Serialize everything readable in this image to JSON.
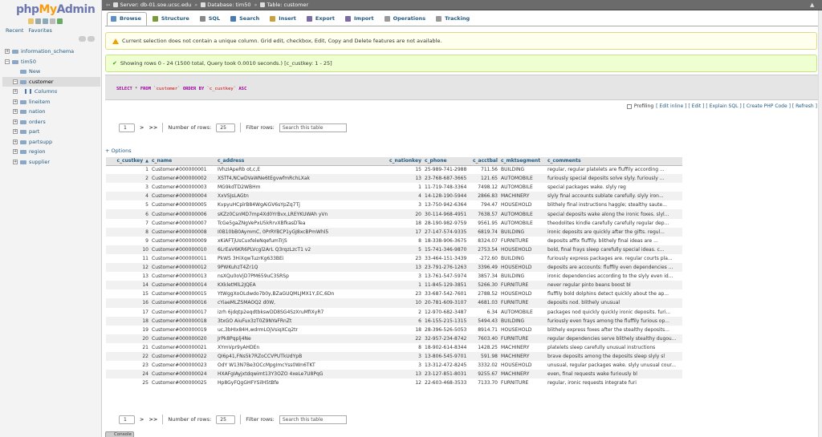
{
  "logo": {
    "php": "php",
    "my": "My",
    "admin": "Admin"
  },
  "nav": {
    "tab_recent": "Recent",
    "tab_favorites": "Favorites",
    "tree": [
      {
        "label": "information_schema",
        "level": 0,
        "expander": "+"
      },
      {
        "label": "tim50",
        "level": 0,
        "expander": "−"
      },
      {
        "label": "New",
        "level": 1,
        "expander": ""
      },
      {
        "label": "customer",
        "level": 1,
        "expander": "−",
        "selected": true
      },
      {
        "label": "Columns",
        "level": 2,
        "expander": "+"
      },
      {
        "label": "lineitem",
        "level": 1,
        "expander": "+"
      },
      {
        "label": "nation",
        "level": 1,
        "expander": "+"
      },
      {
        "label": "orders",
        "level": 1,
        "expander": "+"
      },
      {
        "label": "part",
        "level": 1,
        "expander": "+"
      },
      {
        "label": "partsupp",
        "level": 1,
        "expander": "+"
      },
      {
        "label": "region",
        "level": 1,
        "expander": "+"
      },
      {
        "label": "supplier",
        "level": 1,
        "expander": "+"
      }
    ]
  },
  "breadcrumb": {
    "server": "Server: db-01.soe.ucsc.edu",
    "database": "Database: tim50",
    "table": "Table: customer"
  },
  "tabs": [
    {
      "label": "Browse",
      "name": "tab-browse",
      "active": true,
      "color": "#5b8fc6"
    },
    {
      "label": "Structure",
      "name": "tab-structure",
      "color": "#7a9a3a"
    },
    {
      "label": "SQL",
      "name": "tab-sql",
      "color": "#888888"
    },
    {
      "label": "Search",
      "name": "tab-search",
      "color": "#4a7bb0"
    },
    {
      "label": "Insert",
      "name": "tab-insert",
      "color": "#c8a040"
    },
    {
      "label": "Export",
      "name": "tab-export",
      "color": "#7b6aa8"
    },
    {
      "label": "Import",
      "name": "tab-import",
      "color": "#7b6aa8"
    },
    {
      "label": "Operations",
      "name": "tab-operations",
      "color": "#999999"
    },
    {
      "label": "Tracking",
      "name": "tab-tracking",
      "color": "#999999"
    }
  ],
  "messages": {
    "warning": "Current selection does not contain a unique column. Grid edit, checkbox, Edit, Copy and Delete features are not available.",
    "success": "Showing rows 0 - 24 (1500 total, Query took 0.0010 seconds.) [c_custkey: 1 - 25]"
  },
  "sql": {
    "kw1": "SELECT",
    "star": " * ",
    "kw2": "FROM",
    "table": " `customer` ",
    "kw3": "ORDER BY",
    "col": " `c_custkey` ",
    "kw4": "ASC"
  },
  "profiling": {
    "label": "Profiling",
    "links": "[ Edit inline ] [ Edit ] [ Explain SQL ] [ Create PHP Code ] [ Refresh ]"
  },
  "pager": {
    "page": "1",
    "next": ">",
    "last": ">>",
    "rows_label": "Number of rows:",
    "rows_value": "25",
    "filter_label": "Filter rows:",
    "filter_placeholder": "Search this table"
  },
  "options_label": "+ Options",
  "table": {
    "headers": [
      "c_custkey",
      "c_name",
      "c_address",
      "c_nationkey",
      "c_phone",
      "c_acctbal",
      "c_mktsegment",
      "c_comments"
    ],
    "sort_arrow": "▲",
    "rows": [
      [
        "1",
        "Customer#000000001",
        "IVhzIApeRb ot,c,E",
        "15",
        "25-989-741-2988",
        "711.56",
        "BUILDING",
        "regular, regular platelets are fluffily according ..."
      ],
      [
        "2",
        "Customer#000000002",
        "XSTf4,NCwDVaWNe6tEgvwfmRchLXak",
        "13",
        "23-768-687-3665",
        "121.65",
        "AUTOMOBILE",
        "furiously special deposits solve slyly. furiously ..."
      ],
      [
        "3",
        "Customer#000000003",
        "MG9kdTD2WBHm",
        "1",
        "11-719-748-3364",
        "7498.12",
        "AUTOMOBILE",
        "special packages wake. slyly reg"
      ],
      [
        "4",
        "Customer#000000004",
        "XxVSJsLAGtn",
        "4",
        "14-128-190-5944",
        "2866.83",
        "MACHINERY",
        "slyly final accounts sublate carefully. slyly iron..."
      ],
      [
        "5",
        "Customer#000000005",
        "KvpyuHCplrB84WgAiGV6sYpZq7Tj",
        "3",
        "13-750-942-6364",
        "794.47",
        "HOUSEHOLD",
        "blithely final instructions haggle; stealthy saute..."
      ],
      [
        "6",
        "Customer#000000006",
        "sKZz0CsnMD7mp4Xd0YrBvx,LREYKUWAh yVn",
        "20",
        "30-114-968-4951",
        "7638.57",
        "AUTOMOBILE",
        "special deposits wake along the ironic foxes. slyl..."
      ],
      [
        "7",
        "Customer#000000007",
        "TcGe5gaZNgVePxU5kRrvXBfkasDTea",
        "18",
        "28-190-982-9759",
        "9561.95",
        "AUTOMOBILE",
        "theodolites kindle carefully carefully regular dep..."
      ],
      [
        "8",
        "Customer#000000008",
        "I0B10bB0AymmC, 0PrRYBCP1yGJ8xcBPmWhl5",
        "17",
        "27-147-574-9335",
        "6819.74",
        "BUILDING",
        "ironic deposits are quickly after the gifts. regul..."
      ],
      [
        "9",
        "Customer#000000009",
        "xKiAFTjUsCuxfeleNqefumTrjS",
        "8",
        "18-338-906-3675",
        "8324.07",
        "FURNITURE",
        "deposits affix fluffily. blithely final ideas are ..."
      ],
      [
        "10",
        "Customer#000000010",
        "6LrEaV6KR6PLVcgl2ArL Q3rqzLzcT1 v2",
        "5",
        "15-741-346-9870",
        "2753.54",
        "HOUSEHOLD",
        "bold, final frays sleep carefully special ideas. c..."
      ],
      [
        "11",
        "Customer#000000011",
        "PkWS 3HiXqwTuzrKg633BEi",
        "23",
        "33-464-151-3439",
        "-272.60",
        "BUILDING",
        "furiously express packages are. regular courts pla..."
      ],
      [
        "12",
        "Customer#000000012",
        "9PWKuhzT4Zr1Q",
        "13",
        "23-791-276-1263",
        "3396.49",
        "HOUSEHOLD",
        "deposits are accounts: fluffily even dependencies ..."
      ],
      [
        "13",
        "Customer#000000013",
        "nsXQu0oVjD7PM659uC3SRSp",
        "3",
        "13-761-547-5974",
        "3857.34",
        "BUILDING",
        "ironic dependencies according to the slyly even id..."
      ],
      [
        "14",
        "Customer#000000014",
        "KXkletMlL2JQEA",
        "1",
        "11-845-129-3851",
        "5266.30",
        "FURNITURE",
        "never regular pinto beans boost bl"
      ],
      [
        "15",
        "Customer#000000015",
        "YtWggXoOLdwdo7b0y,BZaGUQMLJMX1Y,EC,6Dn",
        "23",
        "33-687-542-7601",
        "2788.52",
        "HOUSEHOLD",
        "fluffily bold dolphins detect quickly about the ap..."
      ],
      [
        "16",
        "Customer#000000016",
        "cYiaeMLZSMAOQ2 d0W,",
        "10",
        "20-781-609-3107",
        "4681.03",
        "FURNITURE",
        "deposits nod. blithely unusual"
      ],
      [
        "17",
        "Customer#000000017",
        "izrh 6jdqtp2eqdtbkswDD8SG4SzXruMfIXyR7",
        "2",
        "12-970-682-3487",
        "6.34",
        "AUTOMOBILE",
        "packages nod quickly quickly ironic deposits. furi..."
      ],
      [
        "18",
        "Customer#000000018",
        "3txGO AiuFux3zT0Z9NYaFRnZt",
        "6",
        "16-155-215-1315",
        "5494.43",
        "BUILDING",
        "furiously even frays among the fluffily furious op..."
      ],
      [
        "19",
        "Customer#000000019",
        "uc,3bHIx84H,wdrmLOjVsiqXCq2tr",
        "18",
        "28-396-526-5053",
        "8914.71",
        "HOUSEHOLD",
        "blithely express foxes after the stealthy deposits..."
      ],
      [
        "20",
        "Customer#000000020",
        "JrPk8Pqplj4Ne",
        "22",
        "32-957-234-8742",
        "7603.40",
        "FURNITURE",
        "regular dependencies serve blithely stealthy dugou..."
      ],
      [
        "21",
        "Customer#000000021",
        "XYmVpr9yAHDEn",
        "8",
        "18-902-614-8344",
        "1428.25",
        "MACHINERY",
        "platelets sleep carefully unusual instructions"
      ],
      [
        "22",
        "Customer#000000022",
        "QI6p41,FNs5k7RZoCCVPUTkUdYpB",
        "3",
        "13-806-545-9701",
        "591.98",
        "MACHINERY",
        "brave deposits among the deposits sleep slyly sl"
      ],
      [
        "23",
        "Customer#000000023",
        "OdY W13N7Be3OCcMpgImcYss0Wn6TKT",
        "3",
        "13-312-472-8245",
        "3332.02",
        "HOUSEHOLD",
        "unusual, regular packages wake. slyly unusual cour..."
      ],
      [
        "24",
        "Customer#000000024",
        "HXAFgIAyjxtdqwimt13Y3OZO 4xeLe7U8PqG",
        "13",
        "23-127-851-8031",
        "9255.67",
        "MACHINERY",
        "even, final requests wake furiously bl"
      ],
      [
        "25",
        "Customer#000000025",
        "Hp8GyFQgGHFYSilH5tBfe",
        "12",
        "22-603-468-3533",
        "7133.70",
        "FURNITURE",
        "regular, ironic requests integrate furi"
      ]
    ]
  },
  "console_label": "Console"
}
